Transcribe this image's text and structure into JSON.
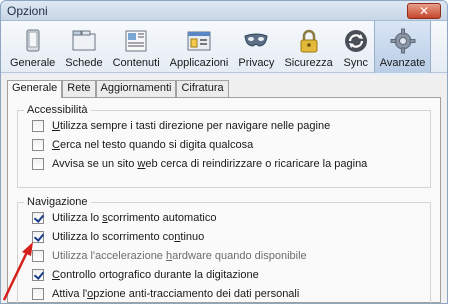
{
  "window": {
    "title": "Opzioni",
    "close_glyph": "✕"
  },
  "toolbar": {
    "items": [
      {
        "label": "Generale",
        "icon": "general-icon",
        "active": false
      },
      {
        "label": "Schede",
        "icon": "tabs-icon",
        "active": false
      },
      {
        "label": "Contenuti",
        "icon": "content-icon",
        "active": false
      },
      {
        "label": "Applicazioni",
        "icon": "applications-icon",
        "active": false
      },
      {
        "label": "Privacy",
        "icon": "privacy-mask-icon",
        "active": false
      },
      {
        "label": "Sicurezza",
        "icon": "padlock-icon",
        "active": false
      },
      {
        "label": "Sync",
        "icon": "sync-icon",
        "active": false
      },
      {
        "label": "Avanzate",
        "icon": "gear-icon",
        "active": true
      }
    ]
  },
  "subtabs": [
    "Generale",
    "Rete",
    "Aggiornamenti",
    "Cifratura"
  ],
  "accessibility": {
    "title": "Accessibilità",
    "options": [
      {
        "pre": "",
        "key": "U",
        "post": "tilizza sempre i tasti direzione per navigare nelle pagine",
        "checked": false
      },
      {
        "pre": "",
        "key": "C",
        "post": "erca nel testo quando si digita qualcosa",
        "checked": false
      },
      {
        "pre": "Avvisa se un sito ",
        "key": "w",
        "post": "eb cerca di reindirizzare o ricaricare la pagina",
        "checked": false
      }
    ]
  },
  "navigation": {
    "title": "Navigazione",
    "options": [
      {
        "pre": "Utilizza lo ",
        "key": "s",
        "post": "corrimento automatico",
        "checked": true
      },
      {
        "pre": "Utilizza lo scorrimento co",
        "key": "n",
        "post": "tinuo",
        "checked": true
      },
      {
        "pre": "Utilizza l'accelerazione ",
        "key": "h",
        "post": "ardware quando disponibile",
        "checked": false
      },
      {
        "pre": "",
        "key": "C",
        "post": "ontrollo ortografico durante la digitazione",
        "checked": true
      },
      {
        "pre": "Attiva l'",
        "key": "o",
        "post": "pzione anti-tracciamento dei dati personali",
        "checked": false
      }
    ]
  },
  "colors": {
    "accent": "#1a3c8c",
    "arrow": "#d6201b",
    "close": "#c5452b"
  }
}
